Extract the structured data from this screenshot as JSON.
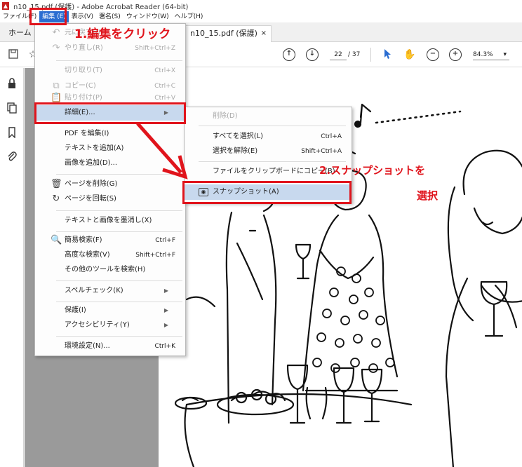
{
  "window": {
    "title": "n10_15.pdf (保護) - Adobe Acrobat Reader (64-bit)",
    "app_icon": "pdf-icon"
  },
  "menubar": {
    "items": [
      {
        "label": "ファイル(F)"
      },
      {
        "label": "編集 (E)"
      },
      {
        "label": "表示(V)"
      },
      {
        "label": "署名(S)"
      },
      {
        "label": "ウィンドウ(W)"
      },
      {
        "label": "ヘルプ(H)"
      }
    ]
  },
  "tabs": {
    "home": "ホーム",
    "document": "n10_15.pdf (保護)",
    "close": "×"
  },
  "toolbar": {
    "page_current": "22",
    "page_total": "/ 37",
    "zoom": "84.3%",
    "zoom_caret": "▾"
  },
  "edit_menu": {
    "items": [
      {
        "label": "元に戻す(U)",
        "shortcut": "",
        "icon": "undo-icon",
        "disabled": true
      },
      {
        "label": "やり直し(R)",
        "shortcut": "Shift+Ctrl+Z",
        "icon": "redo-icon",
        "disabled": true
      },
      {
        "label": "切り取り(T)",
        "shortcut": "Ctrl+X",
        "disabled": true
      },
      {
        "label": "コピー(C)",
        "shortcut": "Ctrl+C",
        "icon": "copy-icon",
        "disabled": true
      },
      {
        "label": "貼り付け(P)",
        "shortcut": "Ctrl+V",
        "icon": "paste-icon",
        "disabled": true
      },
      {
        "label": "詳細(E)...",
        "shortcut": "",
        "submenu": true,
        "highlighted": true
      },
      {
        "label": "PDF を編集(I)",
        "shortcut": ""
      },
      {
        "label": "テキストを追加(A)",
        "shortcut": ""
      },
      {
        "label": "画像を追加(D)...",
        "shortcut": ""
      },
      {
        "label": "ページを削除(G)",
        "shortcut": "",
        "icon": "trash-icon"
      },
      {
        "label": "ページを回転(S)",
        "shortcut": "",
        "icon": "rotate-icon"
      },
      {
        "label": "テキストと画像を墨消し(X)",
        "shortcut": ""
      },
      {
        "label": "簡易検索(F)",
        "shortcut": "Ctrl+F",
        "icon": "search-icon"
      },
      {
        "label": "高度な検索(V)",
        "shortcut": "Shift+Ctrl+F"
      },
      {
        "label": "その他のツールを検索(H)",
        "shortcut": ""
      },
      {
        "label": "スペルチェック(K)",
        "shortcut": "",
        "submenu": true
      },
      {
        "label": "保護(I)",
        "shortcut": "",
        "submenu": true
      },
      {
        "label": "アクセシビリティ(Y)",
        "shortcut": "",
        "submenu": true
      },
      {
        "label": "環境設定(N)...",
        "shortcut": "Ctrl+K"
      }
    ]
  },
  "sub_menu": {
    "items": [
      {
        "label": "削除(D)",
        "shortcut": "",
        "disabled": true
      },
      {
        "label": "すべてを選択(L)",
        "shortcut": "Ctrl+A"
      },
      {
        "label": "選択を解除(E)",
        "shortcut": "Shift+Ctrl+A"
      },
      {
        "label": "ファイルをクリップボードにコピー(B)",
        "shortcut": ""
      },
      {
        "label": "スナップショット(A)",
        "shortcut": "",
        "icon": "camera-icon",
        "highlighted": true
      }
    ]
  },
  "annotations": {
    "step1": "1.編集をクリック",
    "step2_line1": "2.スナップショットを",
    "step2_line2": "選択",
    "color": "#e0141c"
  },
  "colors": {
    "menu_highlight": "#c8d9ee",
    "menubar_active": "#2a6dd1",
    "doc_background": "#9a9a9a"
  }
}
